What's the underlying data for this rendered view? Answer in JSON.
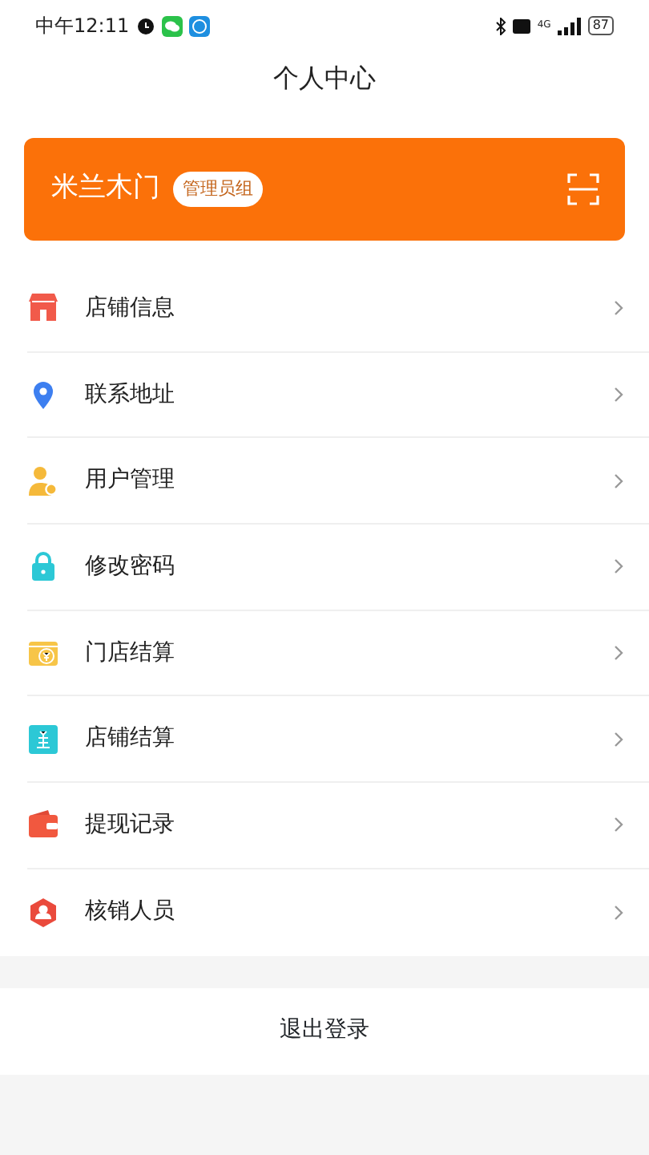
{
  "status_bar": {
    "time": "中午12:11",
    "network": "4G",
    "battery": "87"
  },
  "title": "个人中心",
  "shop_card": {
    "name": "米兰木门",
    "role": "管理员组"
  },
  "menu": [
    {
      "label": "店铺信息",
      "kind": "store"
    },
    {
      "label": "联系地址",
      "kind": "pin"
    },
    {
      "label": "用户管理",
      "kind": "user"
    },
    {
      "label": "修改密码",
      "kind": "lock"
    },
    {
      "label": "门店结算",
      "kind": "coin"
    },
    {
      "label": "店铺结算",
      "kind": "bill"
    },
    {
      "label": "提现记录",
      "kind": "wallet"
    },
    {
      "label": "核销人员",
      "kind": "person"
    }
  ],
  "logout": "退出登录"
}
